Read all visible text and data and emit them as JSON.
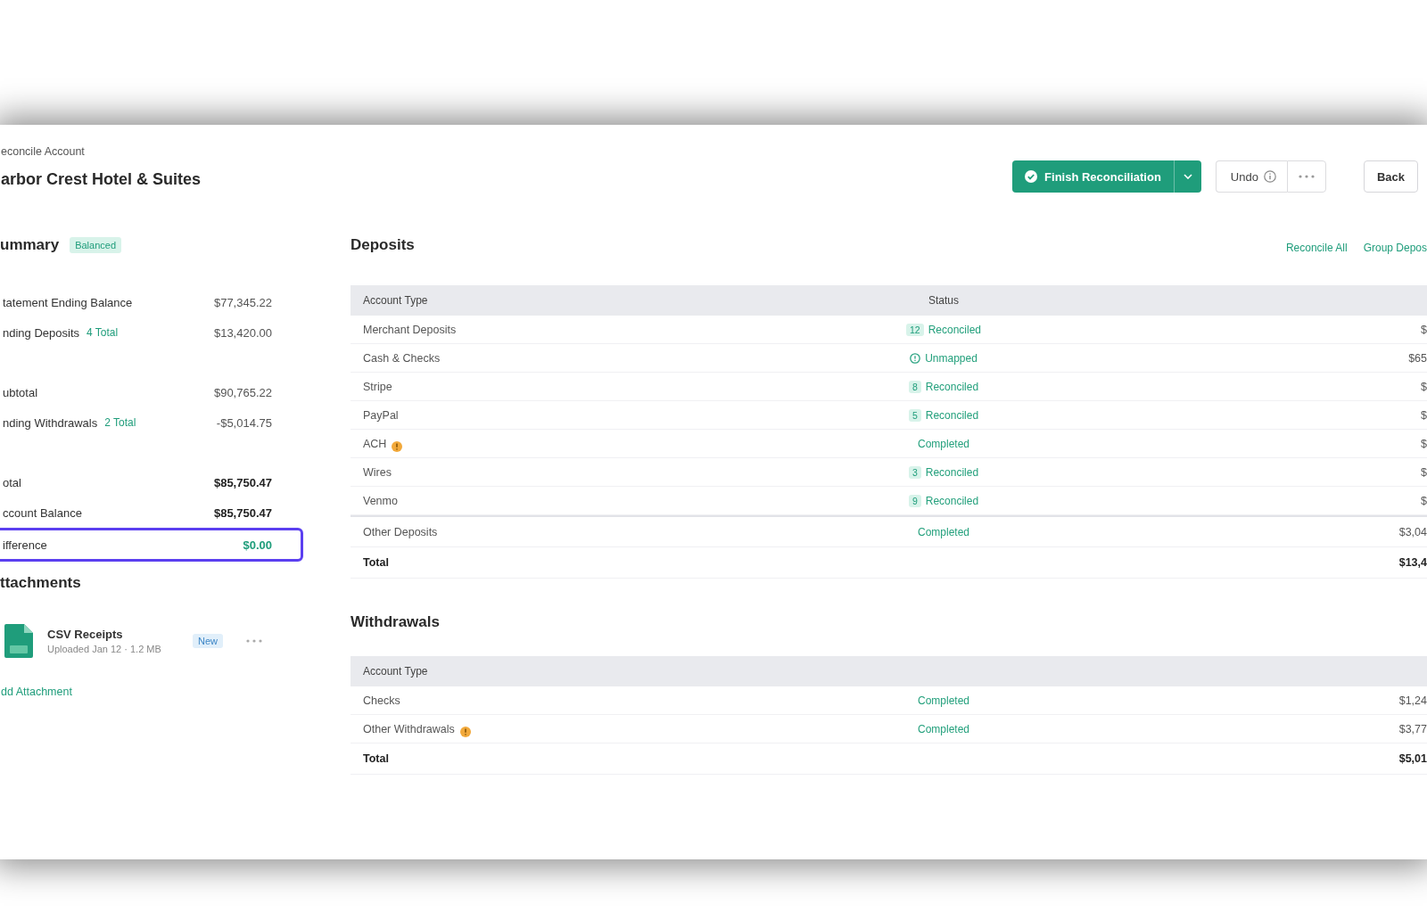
{
  "header": {
    "breadcrumb": "econcile Account",
    "title": "arbor Crest Hotel & Suites",
    "actions": {
      "primary": "Finish Reconciliation",
      "secondary": "Undo",
      "back": "Back"
    }
  },
  "summary": {
    "title": "ummary",
    "tag": "Balanced",
    "groups": [
      {
        "rows": [
          {
            "label": "tatement Ending Balance",
            "value": "$77,345.22",
            "kind": "normal",
            "highlighted": false
          },
          {
            "label": "nding Deposits",
            "link": "4 Total",
            "value": "$13,420.00",
            "kind": "normal",
            "highlighted": false
          }
        ]
      },
      {
        "rows": [
          {
            "label": "ubtotal",
            "value": "$90,765.22",
            "kind": "normal",
            "highlighted": false
          },
          {
            "label": "nding Withdrawals",
            "link": "2 Total",
            "value": "-$5,014.75",
            "kind": "normal",
            "highlighted": false
          }
        ]
      },
      {
        "rows": [
          {
            "label": "otal",
            "value": "$85,750.47",
            "kind": "strong",
            "highlighted": false
          },
          {
            "label": "ccount Balance",
            "value": "$85,750.47",
            "kind": "strong",
            "highlighted": false
          },
          {
            "label": "ifference",
            "value": "$0.00",
            "kind": "result",
            "highlighted": true
          }
        ]
      }
    ]
  },
  "attachments": {
    "title": "ttachments",
    "items": [
      {
        "name": "CSV Receipts",
        "meta": "Uploaded Jan 12 · 1.2 MB",
        "tag": "New"
      }
    ],
    "add_link": "dd Attachment"
  },
  "deposits": {
    "title": "Deposits",
    "actions": [
      "Reconcile All",
      "Group Depos"
    ],
    "columns": [
      "Account Type",
      "Status"
    ],
    "rows": [
      {
        "kind": "account",
        "label": "Merchant Deposits",
        "warning": false,
        "status": {
          "kind": "count",
          "count": "12",
          "text": "Reconciled"
        },
        "amount": "$"
      },
      {
        "kind": "account",
        "label": "Cash & Checks",
        "warning": false,
        "status": {
          "kind": "alert",
          "text": "Unmapped"
        },
        "amount": "$65"
      },
      {
        "kind": "account",
        "label": "Stripe",
        "warning": false,
        "status": {
          "kind": "count",
          "count": "8",
          "text": "Reconciled"
        },
        "amount": "$"
      },
      {
        "kind": "account",
        "label": "PayPal",
        "warning": false,
        "status": {
          "kind": "count",
          "count": "5",
          "text": "Reconciled"
        },
        "amount": "$"
      },
      {
        "kind": "account",
        "label": "ACH",
        "warning": true,
        "status": {
          "kind": "plain",
          "text": "Completed"
        },
        "amount": "$"
      },
      {
        "kind": "account",
        "label": "Wires",
        "warning": false,
        "status": {
          "kind": "count",
          "count": "3",
          "text": "Reconciled"
        },
        "amount": "$"
      },
      {
        "kind": "account",
        "label": "Venmo",
        "warning": false,
        "status": {
          "kind": "count",
          "count": "9",
          "text": "Reconciled"
        },
        "amount": "$"
      },
      {
        "kind": "other",
        "label": "Other Deposits",
        "warning": false,
        "status": {
          "kind": "plain",
          "text": "Completed"
        },
        "amount": "$3,04"
      },
      {
        "kind": "total",
        "label": "Total",
        "warning": false,
        "amount": "$13,4"
      }
    ]
  },
  "withdrawals": {
    "title": "Withdrawals",
    "columns": [
      "Account Type"
    ],
    "rows": [
      {
        "kind": "account",
        "label": "Checks",
        "warning": false,
        "status": {
          "kind": "plain",
          "text": "Completed"
        },
        "amount": "$1,24"
      },
      {
        "kind": "account",
        "label": "Other Withdrawals",
        "warning": true,
        "status": {
          "kind": "plain",
          "text": "Completed"
        },
        "amount": "$3,77"
      },
      {
        "kind": "total",
        "label": "Total",
        "warning": false,
        "amount": "$5,01"
      }
    ]
  }
}
